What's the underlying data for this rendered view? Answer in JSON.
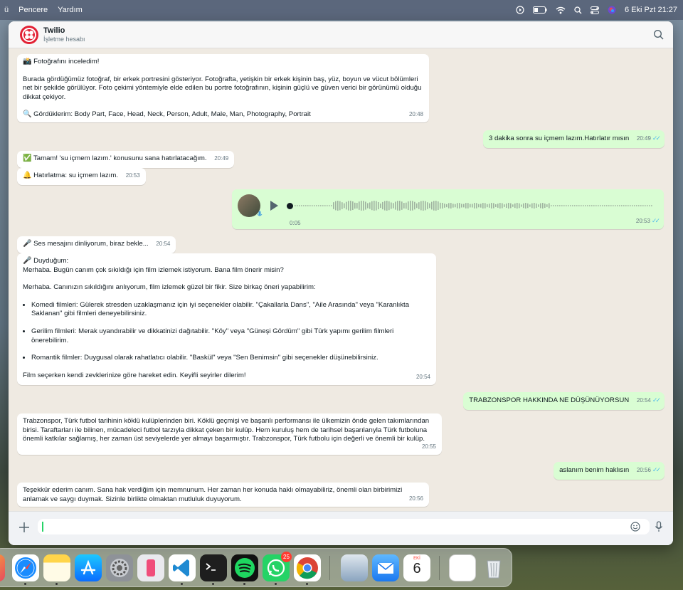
{
  "menubar": {
    "items": [
      "Pencere",
      "Yardım"
    ],
    "datetime": "6 Eki Pzt  21:27"
  },
  "chat": {
    "title": "Twilio",
    "subtitle": "İşletme hesabı"
  },
  "messages": {
    "m1": {
      "heading": "Fotoğrafını inceledim!",
      "body": "Burada gördüğümüz fotoğraf, bir erkek portresini gösteriyor. Fotoğrafta, yetişkin bir erkek kişinin baş, yüz, boyun ve vücut bölümleri net bir şekilde görülüyor. Foto çekimi yöntemiyle elde edilen bu portre fotoğrafının, kişinin güçlü ve güven verici bir görünümü olduğu dikkat çekiyor.",
      "tags": "Gördüklerim: Body Part, Face, Head, Neck, Person, Adult, Male, Man, Photography, Portrait",
      "time": "20:48"
    },
    "m2": {
      "text": "3 dakika sonra su içmem lazım.Hatırlatır mısın",
      "time": "20:49"
    },
    "m3": {
      "text": "Tamam! 'su içmem lazım.' konusunu sana hatırlatacağım.",
      "time": "20:49"
    },
    "m4": {
      "text": "Hatırlatma: su içmem lazım.",
      "time": "20:53"
    },
    "m5": {
      "duration": "0:05",
      "time": "20:53",
      "progress": 0
    },
    "m6": {
      "text": "Ses mesajını dinliyorum, biraz bekle...",
      "time": "20:54"
    },
    "m7": {
      "heading": "Duyduğum:",
      "line1": "Merhaba. Bugün canım çok sıkıldığı için film izlemek istiyorum. Bana film önerir misin?",
      "line2": "Merhaba. Canınızın sıkıldığını anlıyorum, film izlemek güzel bir fikir. Size birkaç öneri yapabilirim:",
      "items": [
        "Komedi filmleri: Gülerek stresden uzaklaşmanız için iyi seçenekler olabilir. \"Çakallarla Dans\", \"Aile Arasında\" veya \"Karanlıkta Saklanan\" gibi filmleri deneyebilirsiniz.",
        "Gerilim filmleri: Merak uyandırabilir ve dikkatinizi dağıtabilir. \"Köy\" veya \"Güneşi Gördüm\" gibi Türk yapımı gerilim filmleri önerebilirim.",
        "Romantik filmler: Duygusal olarak rahatlatıcı olabilir. \"Baskül\" veya \"Sen Benimsin\" gibi seçenekler düşünebilirsiniz."
      ],
      "closing": "Film seçerken kendi zevklerinize göre hareket edin. Keyifli seyirler dilerim!",
      "time": "20:54"
    },
    "m8": {
      "text": "TRABZONSPOR HAKKINDA NE DÜŞÜNÜYORSUN",
      "time": "20:54"
    },
    "m9": {
      "text": "Trabzonspor, Türk futbol tarihinin köklü kulüplerinden biri. Köklü geçmişi ve başarılı performansı ile ülkemizin önde gelen takımlarından birisi. Taraftarları ile bilinen, mücadeleci futbol tarzıyla dikkat çeken bir kulüp. Hem kuruluş hem de tarihsel başarılarıyla Türk futboluna önemli katkılar sağlamış, her zaman üst seviyelerde yer almayı başarmıştır. Trabzonspor, Türk futbolu için değerli ve önemli bir kulüp.",
      "time": "20:55"
    },
    "m10": {
      "text": "aslanım benim haklısın",
      "time": "20:56"
    },
    "m11": {
      "text": "Teşekkür ederim canım. Sana hak verdiğim için memnunum. Her zaman her konuda haklı olmayabiliriz, önemli olan birbirimizi anlamak ve saygı duymak. Sizinle birlikte olmaktan mutluluk duyuyorum.",
      "time": "20:56"
    }
  },
  "composer": {
    "value": "",
    "placeholder": ""
  },
  "dock": {
    "whatsapp_badge": "25",
    "calendar_month": "EKİ",
    "calendar_day": "6"
  },
  "colors": {
    "incoming": "#ffffff",
    "outgoing": "#d9fdd3",
    "chat_bg": "#efeae2",
    "read_ticks": "#53bdeb"
  }
}
